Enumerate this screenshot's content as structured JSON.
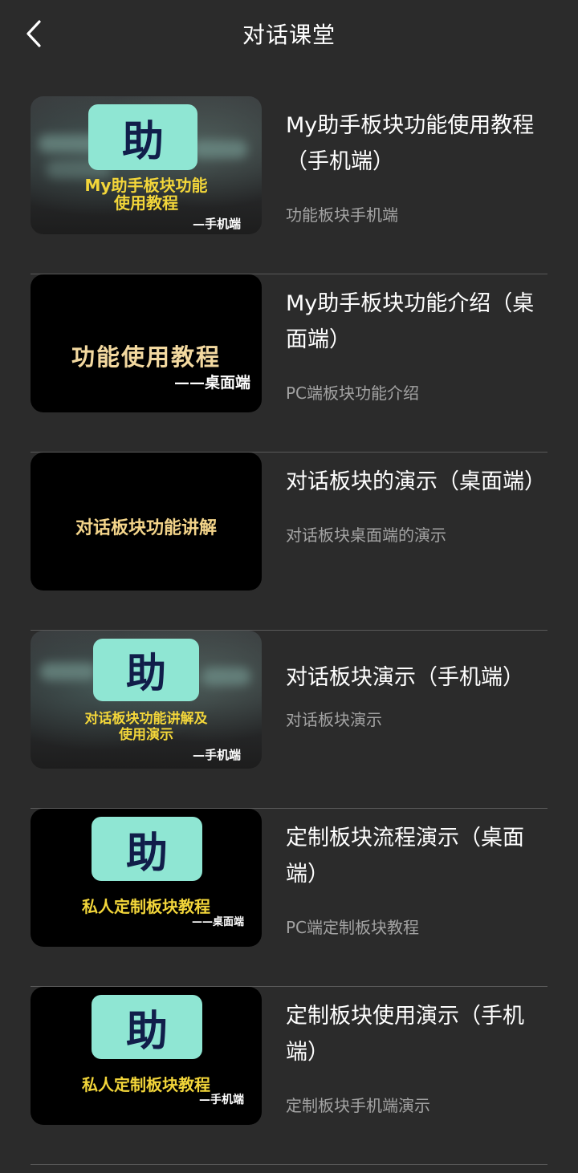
{
  "header": {
    "title": "对话课堂"
  },
  "items": [
    {
      "title": "My助手板块功能使用教程（手机端）",
      "desc": "功能板块手机端",
      "thumb": {
        "logo": "助",
        "caption": "My助手板块功能\n使用教程",
        "sub": "—手机端"
      }
    },
    {
      "title": "My助手板块功能介绍（桌面端）",
      "desc": "PC端板块功能介绍",
      "thumb": {
        "caption": "功能使用教程",
        "sub": "——桌面端"
      }
    },
    {
      "title": "对话板块的演示（桌面端）",
      "desc": "对话板块桌面端的演示",
      "thumb": {
        "caption": "对话板块功能讲解"
      }
    },
    {
      "title": "对话板块演示（手机端）",
      "desc": "对话板块演示",
      "thumb": {
        "logo": "助",
        "caption": "对话板块功能讲解及\n使用演示",
        "sub": "—手机端"
      }
    },
    {
      "title": "定制板块流程演示（桌面端）",
      "desc": "PC端定制板块教程",
      "thumb": {
        "logo": "助",
        "caption": "私人定制板块教程",
        "sub": "——桌面端"
      }
    },
    {
      "title": "定制板块使用演示（手机端）",
      "desc": "定制板块手机端演示",
      "thumb": {
        "logo": "助",
        "caption": "私人定制板块教程",
        "sub": "—手机端"
      }
    }
  ]
}
